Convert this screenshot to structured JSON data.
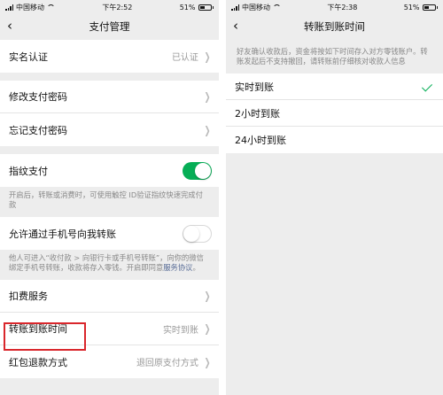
{
  "colors": {
    "accent": "#06ae56",
    "link": "#576b95",
    "highlight": "#d9262b",
    "background": "#ededed"
  },
  "left": {
    "status": {
      "carrier": "中国移动",
      "time": "下午2:52",
      "battery": "51%"
    },
    "nav": {
      "back_icon": "chevron-left-icon",
      "title": "支付管理"
    },
    "rows": {
      "realname": {
        "label": "实名认证",
        "value": "已认证"
      },
      "change_pwd": {
        "label": "修改支付密码"
      },
      "forgot_pwd": {
        "label": "忘记支付密码"
      },
      "fingerprint": {
        "label": "指纹支付",
        "enabled": true,
        "note": "开启后，转账或消费时，可使用触控 ID验证指纹快速完成付款"
      },
      "phone_transfer": {
        "label": "允许通过手机号向我转账",
        "enabled": false,
        "note": "他人可进入“收付款 > 向银行卡或手机号转账”，向你的微信绑定手机号转账，收款将存入零钱。开启即同意",
        "note_link": "服务协议",
        "note_end": "。"
      },
      "deduction": {
        "label": "扣费服务"
      },
      "transfer_time": {
        "label": "转账到账时间",
        "value": "实时到账"
      },
      "refund": {
        "label": "红包退款方式",
        "value": "退回原支付方式"
      }
    }
  },
  "right": {
    "status": {
      "carrier": "中国移动",
      "time": "下午2:38",
      "battery": "51%"
    },
    "nav": {
      "back_icon": "chevron-left-icon",
      "title": "转账到账时间"
    },
    "note": "好友确认收款后，资金将按如下时间存入对方零钱账户。转账发起后不支持撤回，请转账前仔细核对收款人信息",
    "options": [
      {
        "label": "实时到账",
        "selected": true
      },
      {
        "label": "2小时到账",
        "selected": false
      },
      {
        "label": "24小时到账",
        "selected": false
      }
    ]
  }
}
